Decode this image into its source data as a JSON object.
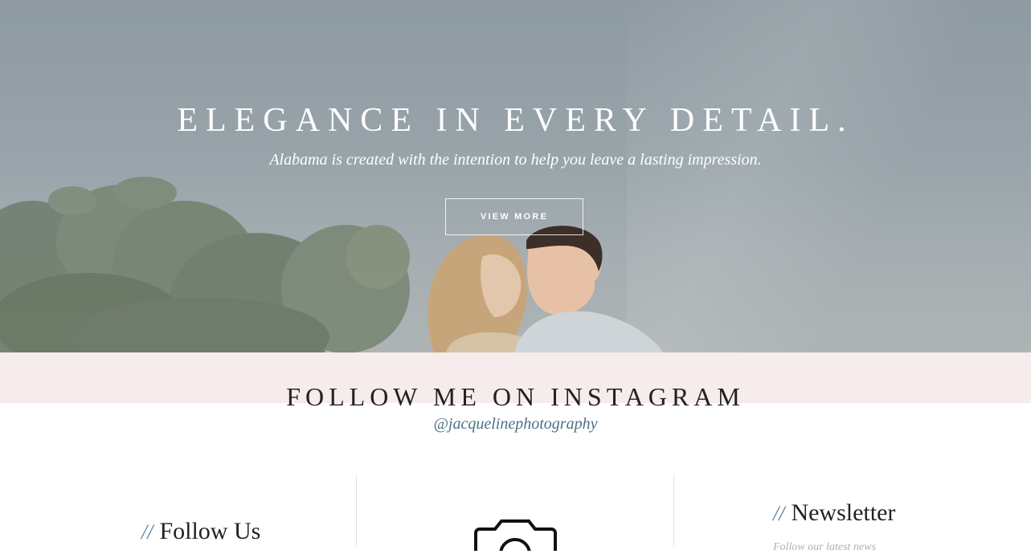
{
  "hero": {
    "title": "ELEGANCE IN EVERY DETAIL.",
    "subtitle": "Alabama is created with the intention to help you leave a lasting impression.",
    "button_label": "VIEW MORE"
  },
  "instagram": {
    "title": "FOLLOW ME ON INSTAGRAM",
    "handle": "@jacquelinephotography"
  },
  "footer": {
    "follow_heading_prefix": "//",
    "follow_heading": "Follow Us",
    "camera_icon": "camera-icon",
    "newsletter_heading_prefix": "//",
    "newsletter_heading": "Newsletter",
    "newsletter_sub": "Follow our latest news"
  },
  "colors": {
    "accent": "#5a7f96",
    "handle": "#4b7185",
    "band": "#f6eceb"
  }
}
